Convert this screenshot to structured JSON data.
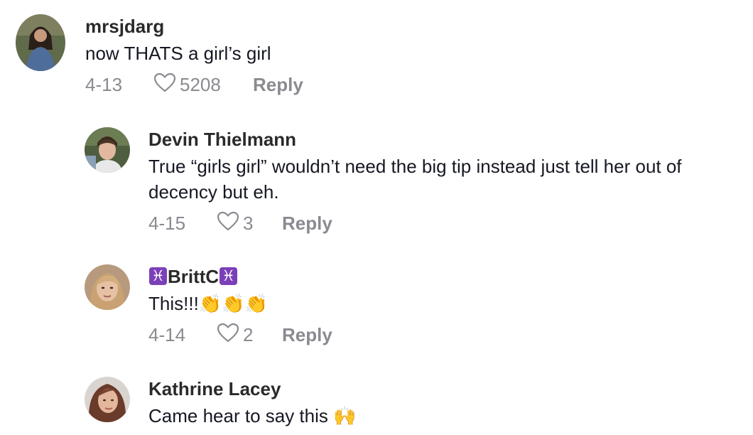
{
  "comments": [
    {
      "username": "mrsjdarg",
      "text": "now THATS a girl’s girl",
      "date": "4-13",
      "likes": "5208",
      "reply_label": "Reply"
    },
    {
      "username": "Devin Thielmann",
      "text": "True “girls girl” wouldn’t need the big tip instead just tell her out of decency but eh.",
      "date": "4-15",
      "likes": "3",
      "reply_label": "Reply"
    },
    {
      "username": "BrittC",
      "username_emoji": "♓",
      "text": "This!!!",
      "text_emoji": "👏👏👏",
      "date": "4-14",
      "likes": "2",
      "reply_label": "Reply"
    },
    {
      "username": "Kathrine Lacey",
      "text": "Came hear to say this",
      "text_emoji": "🙌"
    }
  ],
  "colors": {
    "primary_text": "#161823",
    "secondary_text": "#8a8b91",
    "background": "#ffffff"
  },
  "icons": {
    "like": "heart-outline-icon",
    "zodiac": "pisces-icon",
    "clap": "clapping-hands-emoji",
    "raise": "raising-hands-emoji"
  }
}
